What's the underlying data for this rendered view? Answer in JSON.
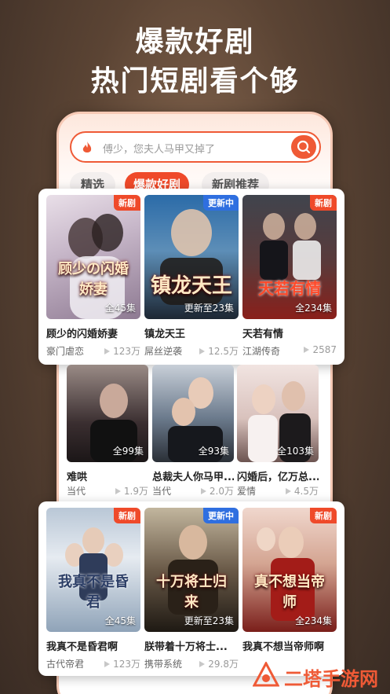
{
  "hero": {
    "line1": "爆款好剧",
    "line2": "热门短剧看个够"
  },
  "search": {
    "placeholder": "傅少，您夫人马甲又掉了"
  },
  "tabs": [
    {
      "label": "精选",
      "active": false
    },
    {
      "label": "爆款好剧",
      "active": true
    },
    {
      "label": "新剧推荐",
      "active": false
    }
  ],
  "rows": [
    [
      {
        "title": "顾少的闪婚娇妻",
        "genre": "豪门虐恋",
        "views": "123万",
        "tag": "新剧",
        "episodes": "全45集",
        "logo": "顾少の闪婚娇妻"
      },
      {
        "title": "镇龙天王",
        "genre": "屌丝逆袭",
        "views": "12.5万",
        "tag": "更新中",
        "episodes": "更新至23集",
        "logo": "镇龙天王"
      },
      {
        "title": "天若有情",
        "genre": "江湖传奇",
        "views": "2587",
        "tag": "新剧",
        "episodes": "全234集",
        "logo": "天若有情"
      }
    ],
    [
      {
        "title": "难哄",
        "genre": "当代",
        "views": "1.9万",
        "episodes": "全99集"
      },
      {
        "title": "总裁夫人你马甲...",
        "genre": "当代",
        "views": "2.0万",
        "episodes": "全93集"
      },
      {
        "title": "闪婚后，亿万总...",
        "genre": "爱情",
        "views": "4.5万",
        "episodes": "全103集"
      }
    ],
    [
      {
        "title": "我真不是昏君啊",
        "genre": "古代帝君",
        "views": "123万",
        "tag": "新剧",
        "episodes": "全45集",
        "logo": "我真不是昏君"
      },
      {
        "title": "朕带着十万将士...",
        "genre": "携带系统",
        "views": "29.8万",
        "tag": "更新中",
        "episodes": "更新至23集",
        "logo": "十万将士归来"
      },
      {
        "title": "我真不想当帝师啊",
        "genre": "",
        "views": "",
        "tag": "新剧",
        "episodes": "全234集",
        "logo": "真不想当帝师"
      }
    ]
  ],
  "watermark": {
    "text": "二塔手游网"
  },
  "colors": {
    "accent": "#ef5a36",
    "tag_new": "#ef4a2a",
    "tag_updating": "#2f6fe0"
  }
}
